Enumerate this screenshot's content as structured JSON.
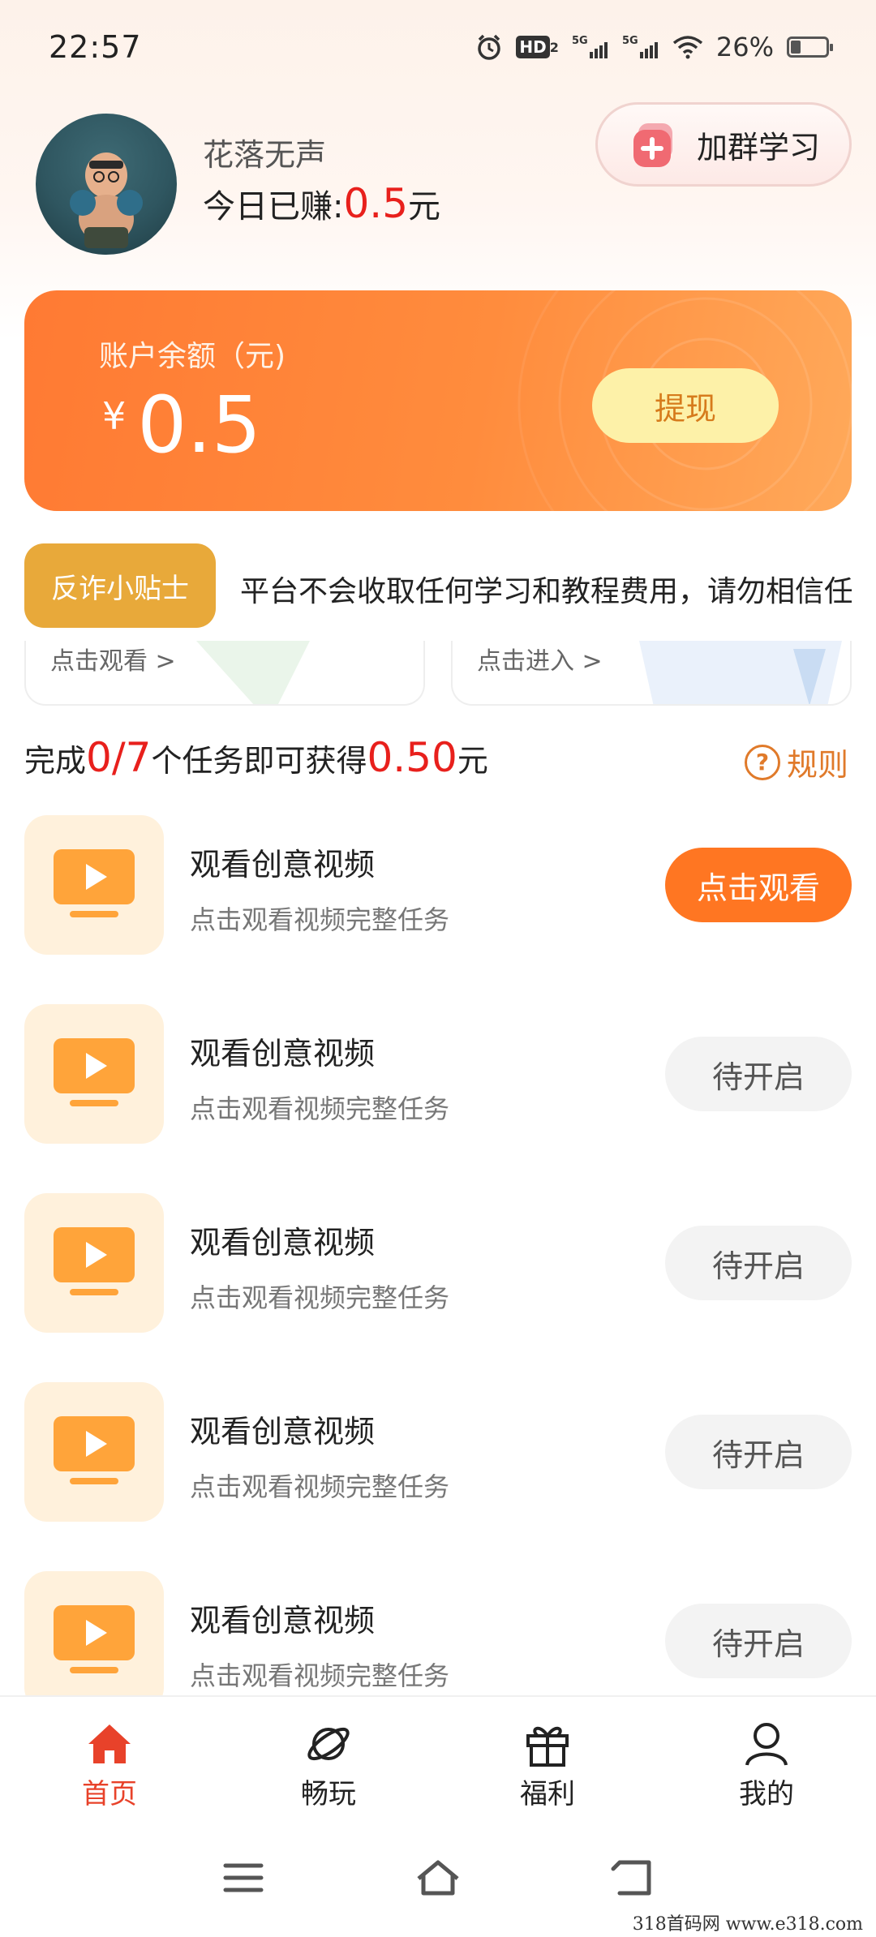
{
  "status_bar": {
    "time": "22:57",
    "battery_percent": "26%",
    "battery_level": 0.26,
    "icons": [
      "alarm-icon",
      "hd-icon",
      "5g-signal-icon",
      "5g-signal-icon",
      "wifi-icon",
      "battery-icon"
    ],
    "hd_label": "HD",
    "hd_sub": "2",
    "network_1": "5G",
    "network_2": "5G"
  },
  "profile": {
    "name": "花落无声",
    "earned_prefix": "今日已赚:",
    "earned_value": "0.5",
    "earned_unit": "元",
    "join_group_label": "加群学习"
  },
  "balance": {
    "label": "账户余额（元)",
    "currency": "¥",
    "amount": "0.5",
    "withdraw_label": "提现"
  },
  "fraud_tip": {
    "tag": "反诈小贴士",
    "text": "平台不会收取任何学习和教程费用，请勿相信任何"
  },
  "mini_cards": [
    {
      "label": "点击观看 >"
    },
    {
      "label": "点击进入 >"
    }
  ],
  "tasks_header": {
    "prefix": "完成",
    "progress": "0/7",
    "middle": "个任务即可获得",
    "reward": "0.50",
    "suffix": "元",
    "rules_label": "规则"
  },
  "tasks": [
    {
      "title": "观看创意视频",
      "subtitle": "点击观看视频完整任务",
      "button": "点击观看",
      "state": "active"
    },
    {
      "title": "观看创意视频",
      "subtitle": "点击观看视频完整任务",
      "button": "待开启",
      "state": "pending"
    },
    {
      "title": "观看创意视频",
      "subtitle": "点击观看视频完整任务",
      "button": "待开启",
      "state": "pending"
    },
    {
      "title": "观看创意视频",
      "subtitle": "点击观看视频完整任务",
      "button": "待开启",
      "state": "pending"
    },
    {
      "title": "观看创意视频",
      "subtitle": "点击观看视频完整任务",
      "button": "待开启",
      "state": "pending"
    }
  ],
  "bottom_nav": [
    {
      "label": "首页",
      "icon": "home-icon",
      "active": true
    },
    {
      "label": "畅玩",
      "icon": "planet-icon",
      "active": false
    },
    {
      "label": "福利",
      "icon": "gift-icon",
      "active": false
    },
    {
      "label": "我的",
      "icon": "person-icon",
      "active": false
    }
  ],
  "system_nav": [
    "menu-icon",
    "home-outline-icon",
    "back-icon"
  ],
  "watermark": "318首码网  www.e318.com",
  "colors": {
    "accent_orange": "#ff7622",
    "balance_card_start": "#ff7a33",
    "balance_card_end": "#ffa95a",
    "highlight_red": "#e8201c",
    "fraud_tag": "#e8a93a",
    "withdraw_btn": "#fdf1a8",
    "task_thumb_bg": "#fff1dc"
  }
}
